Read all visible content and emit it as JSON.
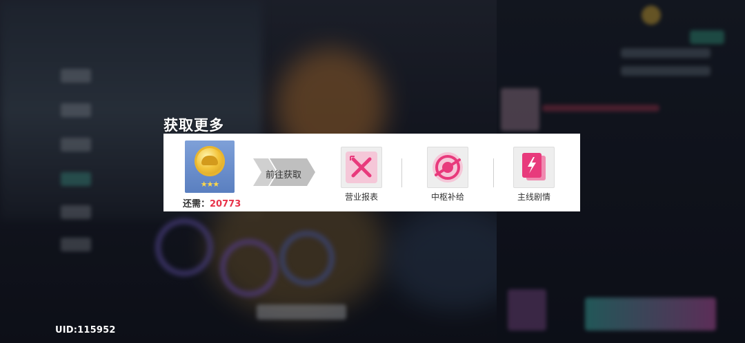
{
  "popup": {
    "title": "获取更多",
    "goto_label": "前往获取",
    "need_label": "还需：",
    "need_value": "20773",
    "need_color": "#e8334a",
    "item_icon": "gold-coin-icon",
    "item_stars": "★★★",
    "sources": [
      {
        "label": "营业报表",
        "icon": "crossed-utensils-icon"
      },
      {
        "label": "中枢补给",
        "icon": "supply-stamp-icon"
      },
      {
        "label": "主线剧情",
        "icon": "story-book-icon"
      }
    ]
  },
  "footer": {
    "uid": "UID:115952"
  },
  "colors": {
    "accent_pink": "#ea4a8c",
    "card_blue": "#6a8fcc"
  }
}
